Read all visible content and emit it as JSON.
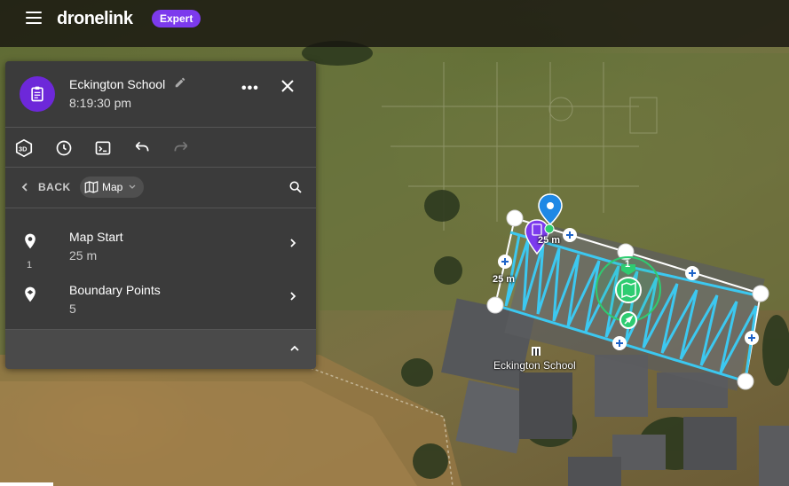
{
  "app": {
    "name": "dronelink",
    "plan_badge": "Expert"
  },
  "panel": {
    "title": "Eckington School",
    "time": "8:19:30 pm",
    "more_label": "•••",
    "back_label": "BACK",
    "context_chip": "Map",
    "tools": [
      "3d-icon",
      "history-icon",
      "terminal-icon",
      "undo-icon",
      "redo-icon"
    ],
    "items": [
      {
        "title": "Map Start",
        "subtitle": "25 m",
        "number": "1",
        "icon": "map-pin-icon"
      },
      {
        "title": "Boundary Points",
        "subtitle": "5",
        "icon": "boundary-pin-icon"
      }
    ]
  },
  "map": {
    "place_label": "Eckington School",
    "distance_label_1": "25 m",
    "distance_label_2": "25 m",
    "component_index": "1"
  },
  "colors": {
    "accent": "#7c3aed",
    "path": "#3cc8f0",
    "boundary": "#ffffff",
    "green": "#2ecc71",
    "pin_blue": "#1e88e5"
  }
}
